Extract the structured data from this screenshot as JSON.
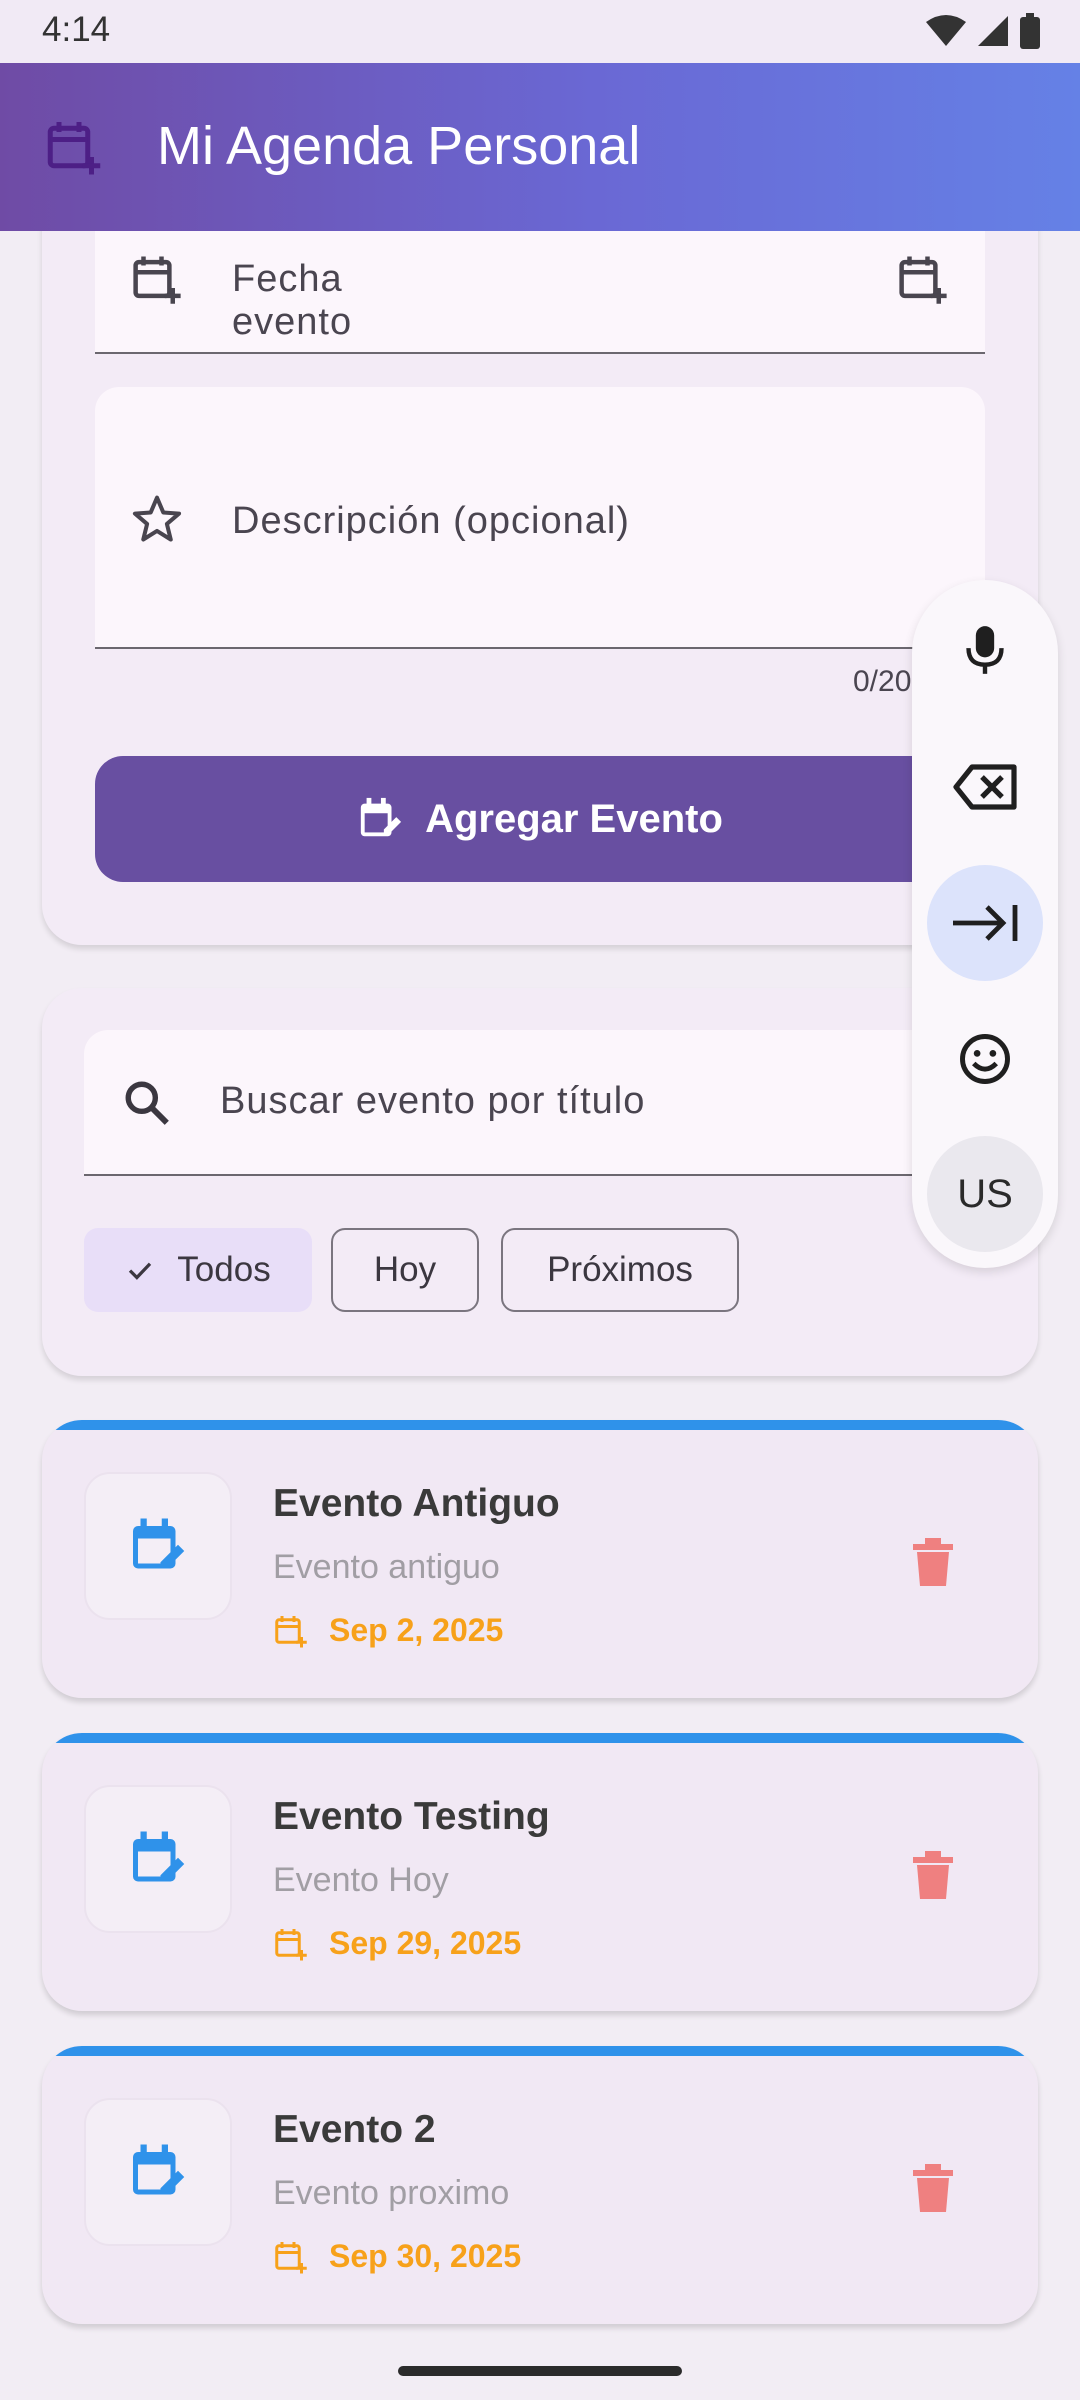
{
  "status_bar": {
    "time": "4:14"
  },
  "app_bar": {
    "title": "Mi Agenda Personal"
  },
  "form": {
    "date_label": "Fecha evento",
    "description_label": "Descripción (opcional)",
    "counter": "0/20",
    "add_button": "Agregar Evento"
  },
  "search": {
    "placeholder": "Buscar evento por título",
    "filters": {
      "todos": "Todos",
      "hoy": "Hoy",
      "proximos": "Próximos"
    },
    "selected_filter": "Todos"
  },
  "events": [
    {
      "title": "Evento Antiguo",
      "description": "Evento antiguo",
      "date": "Sep 2, 2025"
    },
    {
      "title": "Evento Testing",
      "description": "Evento Hoy",
      "date": "Sep 29, 2025"
    },
    {
      "title": "Evento 2",
      "description": "Evento proximo",
      "date": "Sep 30, 2025"
    }
  ],
  "keyboard_toolbar": {
    "language": "US"
  },
  "colors": {
    "primary": "#684fa1",
    "accent_blue": "#2f92ea",
    "date_orange": "#f7a11a",
    "delete_red": "#ef8080"
  }
}
